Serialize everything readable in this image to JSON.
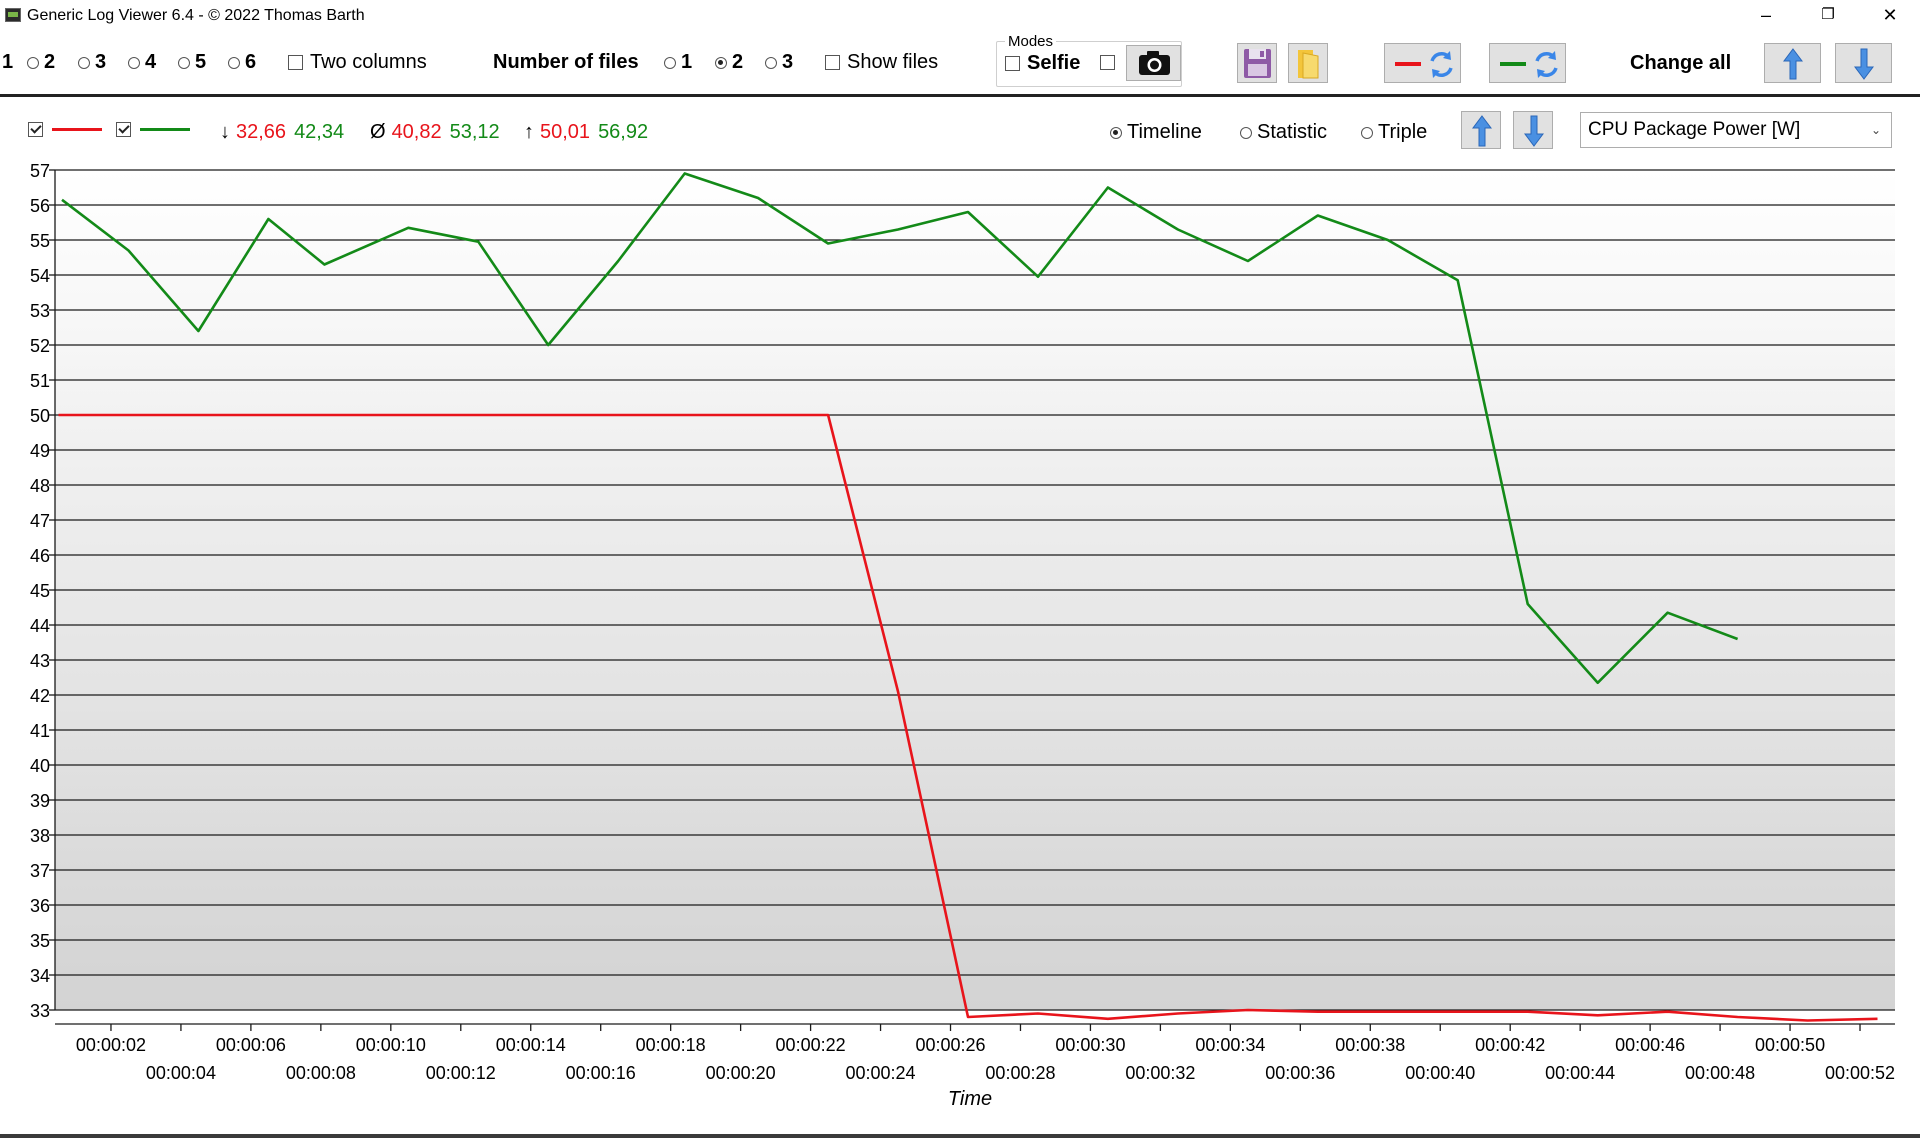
{
  "window": {
    "title": "Generic Log Viewer 6.4 - © 2022 Thomas Barth",
    "minimize_glyph": "–",
    "restore_glyph": "❐",
    "close_glyph": "✕"
  },
  "toolbar": {
    "columns_options": [
      "1",
      "2",
      "3",
      "4",
      "5",
      "6"
    ],
    "two_columns_label": "Two columns",
    "number_of_files_label": "Number of files",
    "file_count_options": [
      "1",
      "2",
      "3"
    ],
    "file_count_selected": "2",
    "show_files_label": "Show files",
    "modes_label": "Modes",
    "selfie_label": "Selfie",
    "change_all_label": "Change all"
  },
  "stats": {
    "min_symbol": "↓",
    "avg_symbol": "Ø",
    "max_symbol": "↑",
    "min_red": "32,66",
    "min_green": "42,34",
    "avg_red": "40,82",
    "avg_green": "53,12",
    "max_red": "50,01",
    "max_green": "56,92"
  },
  "view_modes": {
    "timeline": "Timeline",
    "statistic": "Statistic",
    "triple": "Triple",
    "selected": "Timeline"
  },
  "sensor_select": {
    "value": "CPU Package Power [W]"
  },
  "colors": {
    "red_series": "#e8141b",
    "green_series": "#138a18",
    "accent_blue": "#3a86e8"
  },
  "chart_data": {
    "type": "line",
    "xlabel": "Time",
    "ylim": [
      33,
      57
    ],
    "xlim": [
      0.4,
      53
    ],
    "yticks": [
      33,
      34,
      35,
      36,
      37,
      38,
      39,
      40,
      41,
      42,
      43,
      44,
      45,
      46,
      47,
      48,
      49,
      50,
      51,
      52,
      53,
      54,
      55,
      56,
      57
    ],
    "xticks_upper": [
      "00:00:02",
      "00:00:06",
      "00:00:10",
      "00:00:14",
      "00:00:18",
      "00:00:22",
      "00:00:26",
      "00:00:30",
      "00:00:34",
      "00:00:38",
      "00:00:42",
      "00:00:46",
      "00:00:50"
    ],
    "xticks_lower": [
      "00:00:04",
      "00:00:08",
      "00:00:12",
      "00:00:16",
      "00:00:20",
      "00:00:24",
      "00:00:28",
      "00:00:32",
      "00:00:36",
      "00:00:40",
      "00:00:44",
      "00:00:48",
      "00:00:52"
    ],
    "grid": true,
    "series": [
      {
        "color": "#e8141b",
        "points": [
          [
            0.5,
            50.0
          ],
          [
            2.5,
            50.0
          ],
          [
            4.5,
            50.0
          ],
          [
            6.5,
            50.0
          ],
          [
            8.5,
            50.0
          ],
          [
            10.5,
            50.0
          ],
          [
            12.5,
            50.0
          ],
          [
            14.5,
            50.0
          ],
          [
            16.5,
            50.0
          ],
          [
            18.5,
            50.0
          ],
          [
            20.5,
            50.0
          ],
          [
            22.5,
            50.0
          ],
          [
            24.5,
            42.1
          ],
          [
            26.5,
            32.8
          ],
          [
            28.5,
            32.9
          ],
          [
            30.5,
            32.75
          ],
          [
            32.5,
            32.9
          ],
          [
            34.5,
            33.0
          ],
          [
            36.5,
            32.95
          ],
          [
            38.5,
            32.95
          ],
          [
            40.5,
            32.95
          ],
          [
            42.5,
            32.95
          ],
          [
            44.5,
            32.85
          ],
          [
            46.5,
            32.95
          ],
          [
            48.5,
            32.8
          ],
          [
            50.5,
            32.7
          ],
          [
            52.5,
            32.75
          ]
        ]
      },
      {
        "color": "#138a18",
        "points": [
          [
            0.6,
            56.15
          ],
          [
            2.5,
            54.7
          ],
          [
            4.5,
            52.4
          ],
          [
            6.5,
            55.6
          ],
          [
            8.1,
            54.3
          ],
          [
            10.5,
            55.35
          ],
          [
            12.5,
            54.95
          ],
          [
            14.5,
            52.0
          ],
          [
            16.5,
            54.4
          ],
          [
            18.4,
            56.9
          ],
          [
            20.5,
            56.2
          ],
          [
            22.5,
            54.9
          ],
          [
            24.5,
            55.3
          ],
          [
            26.5,
            55.8
          ],
          [
            28.5,
            53.95
          ],
          [
            30.5,
            56.5
          ],
          [
            32.5,
            55.3
          ],
          [
            34.5,
            54.4
          ],
          [
            36.5,
            55.7
          ],
          [
            38.5,
            55.0
          ],
          [
            40.5,
            53.85
          ],
          [
            42.5,
            44.6
          ],
          [
            44.5,
            42.35
          ],
          [
            46.5,
            44.35
          ],
          [
            48.5,
            43.6
          ]
        ]
      }
    ]
  }
}
